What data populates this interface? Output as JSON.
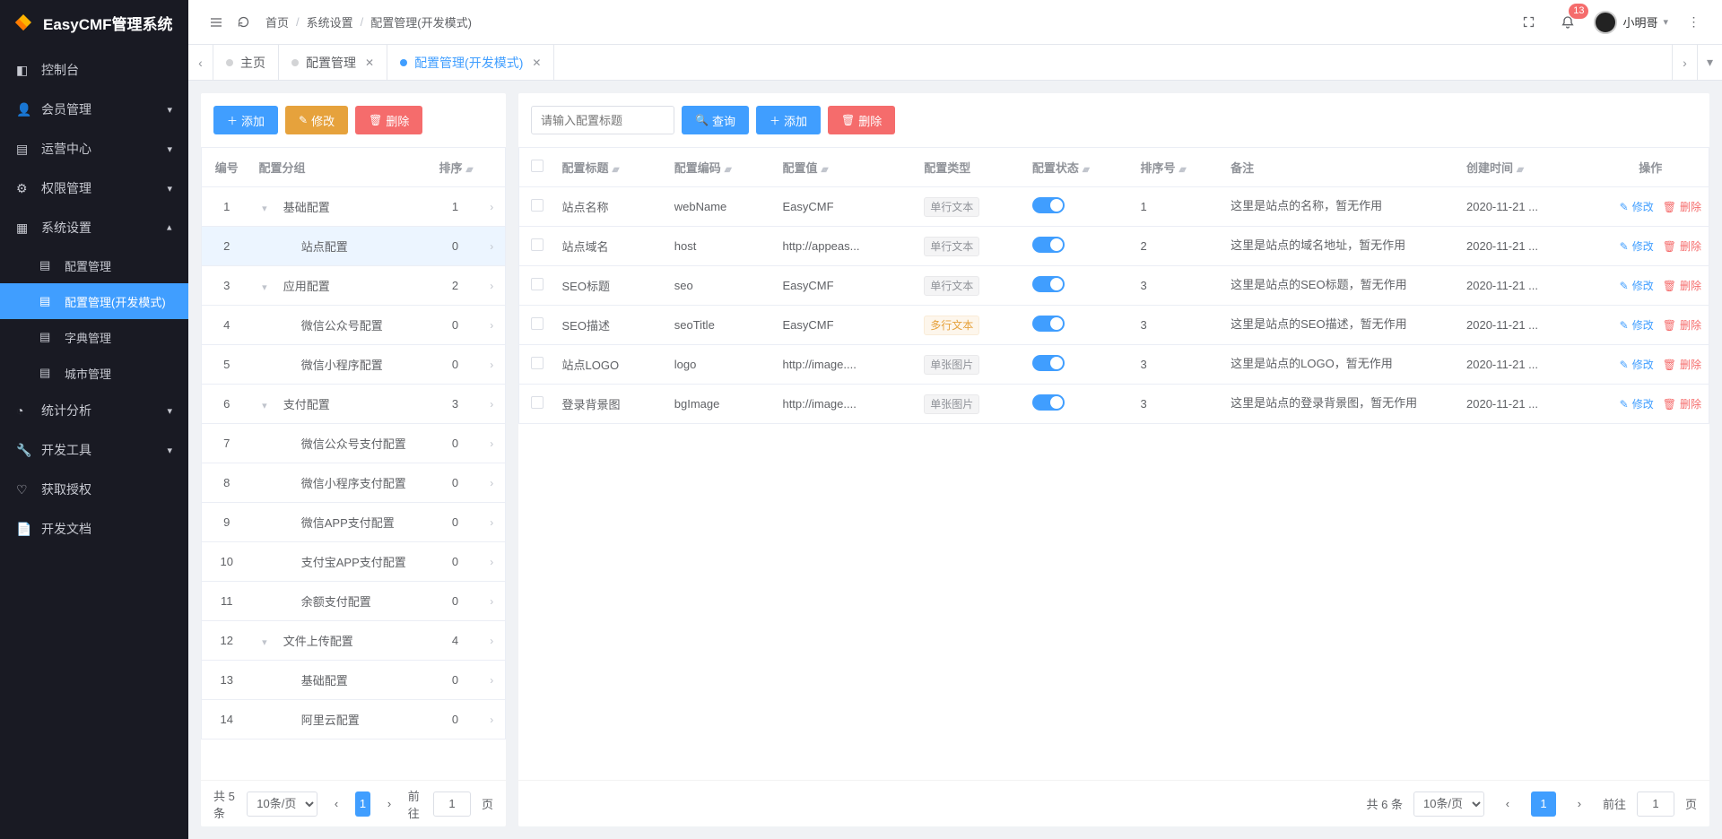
{
  "brand": "EasyCMF管理系统",
  "sidebar": [
    {
      "icon": "console-icon",
      "label": "控制台",
      "hasChildren": false
    },
    {
      "icon": "users-icon",
      "label": "会员管理",
      "hasChildren": true
    },
    {
      "icon": "ops-icon",
      "label": "运营中心",
      "hasChildren": true
    },
    {
      "icon": "perm-icon",
      "label": "权限管理",
      "hasChildren": true
    },
    {
      "icon": "settings-icon",
      "label": "系统设置",
      "hasChildren": true,
      "expanded": true,
      "children": [
        {
          "label": "配置管理"
        },
        {
          "label": "配置管理(开发模式)",
          "active": true
        },
        {
          "label": "字典管理"
        },
        {
          "label": "城市管理"
        }
      ]
    },
    {
      "icon": "stats-icon",
      "label": "统计分析",
      "hasChildren": true
    },
    {
      "icon": "dev-icon",
      "label": "开发工具",
      "hasChildren": true
    },
    {
      "icon": "license-icon",
      "label": "获取授权",
      "hasChildren": false
    },
    {
      "icon": "docs-icon",
      "label": "开发文档",
      "hasChildren": false
    }
  ],
  "breadcrumb": [
    "首页",
    "系统设置",
    "配置管理(开发模式)"
  ],
  "notifications": "13",
  "username": "小明哥",
  "tabs": [
    {
      "label": "主页",
      "closable": false
    },
    {
      "label": "配置管理",
      "closable": true
    },
    {
      "label": "配置管理(开发模式)",
      "closable": true,
      "active": true
    }
  ],
  "leftPanel": {
    "buttons": {
      "add": "添加",
      "edit": "修改",
      "delete": "删除"
    },
    "headers": {
      "no": "编号",
      "group": "配置分组",
      "sort": "排序"
    },
    "rows": [
      {
        "no": 1,
        "indent": 0,
        "caret": true,
        "group": "基础配置",
        "sort": 1
      },
      {
        "no": 2,
        "indent": 1,
        "caret": false,
        "group": "站点配置",
        "sort": 0,
        "selected": true
      },
      {
        "no": 3,
        "indent": 0,
        "caret": true,
        "group": "应用配置",
        "sort": 2
      },
      {
        "no": 4,
        "indent": 1,
        "caret": false,
        "group": "微信公众号配置",
        "sort": 0
      },
      {
        "no": 5,
        "indent": 1,
        "caret": false,
        "group": "微信小程序配置",
        "sort": 0
      },
      {
        "no": 6,
        "indent": 0,
        "caret": true,
        "group": "支付配置",
        "sort": 3
      },
      {
        "no": 7,
        "indent": 1,
        "caret": false,
        "group": "微信公众号支付配置",
        "sort": 0
      },
      {
        "no": 8,
        "indent": 1,
        "caret": false,
        "group": "微信小程序支付配置",
        "sort": 0
      },
      {
        "no": 9,
        "indent": 1,
        "caret": false,
        "group": "微信APP支付配置",
        "sort": 0
      },
      {
        "no": 10,
        "indent": 1,
        "caret": false,
        "group": "支付宝APP支付配置",
        "sort": 0
      },
      {
        "no": 11,
        "indent": 1,
        "caret": false,
        "group": "余额支付配置",
        "sort": 0
      },
      {
        "no": 12,
        "indent": 0,
        "caret": true,
        "group": "文件上传配置",
        "sort": 4
      },
      {
        "no": 13,
        "indent": 1,
        "caret": false,
        "group": "基础配置",
        "sort": 0
      },
      {
        "no": 14,
        "indent": 1,
        "caret": false,
        "group": "阿里云配置",
        "sort": 0
      }
    ],
    "pagination": {
      "total_text": "共 5 条",
      "per_page": "10条/页",
      "page": "1",
      "goto_label": "前往",
      "page_suffix": "页"
    }
  },
  "rightPanel": {
    "search_placeholder": "请输入配置标题",
    "buttons": {
      "search": "查询",
      "add": "添加",
      "delete": "删除"
    },
    "headers": {
      "title": "配置标题",
      "code": "配置编码",
      "value": "配置值",
      "type": "配置类型",
      "status": "配置状态",
      "sort": "排序号",
      "remark": "备注",
      "created": "创建时间",
      "op": "操作"
    },
    "op_labels": {
      "edit": "修改",
      "delete": "删除"
    },
    "type_labels": {
      "single": "单行文本",
      "multi": "多行文本",
      "image": "单张图片"
    },
    "rows": [
      {
        "title": "站点名称",
        "code": "webName",
        "value": "EasyCMF",
        "type": "single",
        "status": true,
        "sort": 1,
        "remark": "这里是站点的名称，暂无作用",
        "created": "2020-11-21 ..."
      },
      {
        "title": "站点域名",
        "code": "host",
        "value": "http://appeas...",
        "type": "single",
        "status": true,
        "sort": 2,
        "remark": "这里是站点的域名地址，暂无作用",
        "created": "2020-11-21 ..."
      },
      {
        "title": "SEO标题",
        "code": "seo",
        "value": "EasyCMF",
        "type": "single",
        "status": true,
        "sort": 3,
        "remark": "这里是站点的SEO标题，暂无作用",
        "created": "2020-11-21 ..."
      },
      {
        "title": "SEO描述",
        "code": "seoTitle",
        "value": "EasyCMF",
        "type": "multi",
        "status": true,
        "sort": 3,
        "remark": "这里是站点的SEO描述，暂无作用",
        "created": "2020-11-21 ..."
      },
      {
        "title": "站点LOGO",
        "code": "logo",
        "value": "http://image....",
        "type": "image",
        "status": true,
        "sort": 3,
        "remark": "这里是站点的LOGO，暂无作用",
        "created": "2020-11-21 ..."
      },
      {
        "title": "登录背景图",
        "code": "bgImage",
        "value": "http://image....",
        "type": "image",
        "status": true,
        "sort": 3,
        "remark": "这里是站点的登录背景图，暂无作用",
        "created": "2020-11-21 ..."
      }
    ],
    "pagination": {
      "total_text": "共 6 条",
      "per_page": "10条/页",
      "page": "1",
      "goto_label": "前往",
      "page_suffix": "页"
    }
  }
}
